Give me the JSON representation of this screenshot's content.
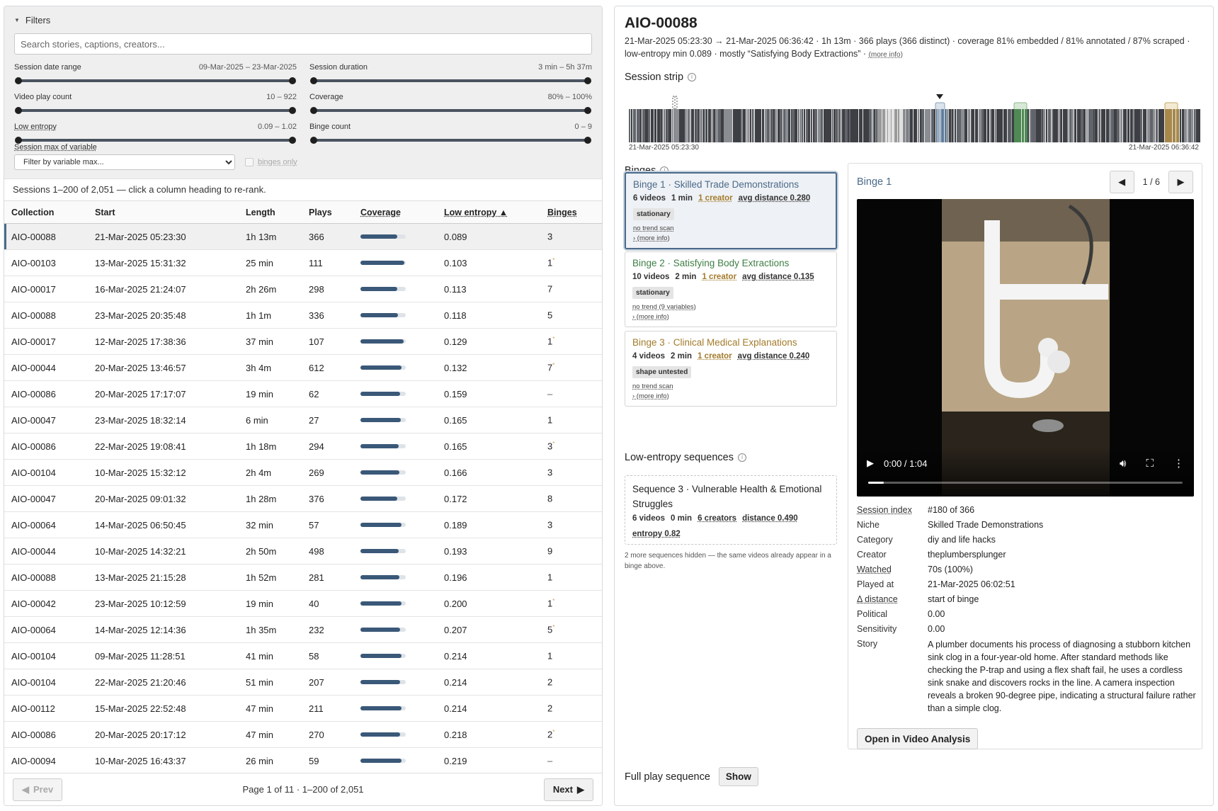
{
  "filters": {
    "heading": "Filters",
    "search_placeholder": "Search stories, captions, creators...",
    "sliders": [
      {
        "label": "Session date range",
        "range": "09-Mar-2025 – 23-Mar-2025"
      },
      {
        "label": "Session duration",
        "range": "3 min – 5h 37m"
      },
      {
        "label": "Video play count",
        "range": "10 – 922"
      },
      {
        "label": "Coverage",
        "range": "80% – 100%"
      },
      {
        "label": "Low entropy",
        "range": "0.09 – 1.02"
      },
      {
        "label": "Binge count",
        "range": "0 – 9"
      }
    ],
    "var_max_label": "Session max of variable",
    "var_max_select": "Filter by variable max...",
    "binges_only_label": "binges only"
  },
  "sessions": {
    "note": "Sessions 1–200 of 2,051 — click a column heading to re-rank.",
    "columns": [
      "Collection",
      "Start",
      "Length",
      "Plays",
      "Coverage",
      "Low entropy ▲",
      "Binges"
    ],
    "rows": [
      {
        "collection": "AIO-00088",
        "start": "21-Mar-2025 05:23:30",
        "length": "1h 13m",
        "plays": "366",
        "coverage": 0.81,
        "entropy": "0.089",
        "binges": "3",
        "mark": ""
      },
      {
        "collection": "AIO-00103",
        "start": "13-Mar-2025 15:31:32",
        "length": "25 min",
        "plays": "111",
        "coverage": 0.97,
        "entropy": "0.103",
        "binges": "1",
        "mark": "*"
      },
      {
        "collection": "AIO-00017",
        "start": "16-Mar-2025 21:24:07",
        "length": "2h 26m",
        "plays": "298",
        "coverage": 0.82,
        "entropy": "0.113",
        "binges": "7",
        "mark": ""
      },
      {
        "collection": "AIO-00088",
        "start": "23-Mar-2025 20:35:48",
        "length": "1h 1m",
        "plays": "336",
        "coverage": 0.83,
        "entropy": "0.118",
        "binges": "5",
        "mark": ""
      },
      {
        "collection": "AIO-00017",
        "start": "12-Mar-2025 17:38:36",
        "length": "37 min",
        "plays": "107",
        "coverage": 0.96,
        "entropy": "0.129",
        "binges": "1",
        "mark": "*"
      },
      {
        "collection": "AIO-00044",
        "start": "20-Mar-2025 13:46:57",
        "length": "3h 4m",
        "plays": "612",
        "coverage": 0.9,
        "entropy": "0.132",
        "binges": "7",
        "mark": "*"
      },
      {
        "collection": "AIO-00086",
        "start": "20-Mar-2025 17:17:07",
        "length": "19 min",
        "plays": "62",
        "coverage": 0.88,
        "entropy": "0.159",
        "binges": "–",
        "mark": ""
      },
      {
        "collection": "AIO-00047",
        "start": "23-Mar-2025 18:32:14",
        "length": "6 min",
        "plays": "27",
        "coverage": 0.89,
        "entropy": "0.165",
        "binges": "1",
        "mark": ""
      },
      {
        "collection": "AIO-00086",
        "start": "22-Mar-2025 19:08:41",
        "length": "1h 18m",
        "plays": "294",
        "coverage": 0.85,
        "entropy": "0.165",
        "binges": "3",
        "mark": "*"
      },
      {
        "collection": "AIO-00104",
        "start": "10-Mar-2025 15:32:12",
        "length": "2h 4m",
        "plays": "269",
        "coverage": 0.86,
        "entropy": "0.166",
        "binges": "3",
        "mark": ""
      },
      {
        "collection": "AIO-00047",
        "start": "20-Mar-2025 09:01:32",
        "length": "1h 28m",
        "plays": "376",
        "coverage": 0.82,
        "entropy": "0.172",
        "binges": "8",
        "mark": ""
      },
      {
        "collection": "AIO-00064",
        "start": "14-Mar-2025 06:50:45",
        "length": "32 min",
        "plays": "57",
        "coverage": 0.9,
        "entropy": "0.189",
        "binges": "3",
        "mark": ""
      },
      {
        "collection": "AIO-00044",
        "start": "10-Mar-2025 14:32:21",
        "length": "2h 50m",
        "plays": "498",
        "coverage": 0.85,
        "entropy": "0.193",
        "binges": "9",
        "mark": ""
      },
      {
        "collection": "AIO-00088",
        "start": "13-Mar-2025 21:15:28",
        "length": "1h 52m",
        "plays": "281",
        "coverage": 0.86,
        "entropy": "0.196",
        "binges": "1",
        "mark": ""
      },
      {
        "collection": "AIO-00042",
        "start": "23-Mar-2025 10:12:59",
        "length": "19 min",
        "plays": "40",
        "coverage": 0.9,
        "entropy": "0.200",
        "binges": "1",
        "mark": "*"
      },
      {
        "collection": "AIO-00064",
        "start": "14-Mar-2025 12:14:36",
        "length": "1h 35m",
        "plays": "232",
        "coverage": 0.88,
        "entropy": "0.207",
        "binges": "5",
        "mark": "*"
      },
      {
        "collection": "AIO-00104",
        "start": "09-Mar-2025 11:28:51",
        "length": "41 min",
        "plays": "58",
        "coverage": 0.9,
        "entropy": "0.214",
        "binges": "1",
        "mark": ""
      },
      {
        "collection": "AIO-00104",
        "start": "22-Mar-2025 21:20:46",
        "length": "51 min",
        "plays": "207",
        "coverage": 0.88,
        "entropy": "0.214",
        "binges": "2",
        "mark": ""
      },
      {
        "collection": "AIO-00112",
        "start": "15-Mar-2025 22:52:48",
        "length": "47 min",
        "plays": "211",
        "coverage": 0.9,
        "entropy": "0.214",
        "binges": "2",
        "mark": ""
      },
      {
        "collection": "AIO-00086",
        "start": "20-Mar-2025 20:17:12",
        "length": "47 min",
        "plays": "270",
        "coverage": 0.88,
        "entropy": "0.218",
        "binges": "2",
        "mark": "*"
      },
      {
        "collection": "AIO-00094",
        "start": "10-Mar-2025 16:43:37",
        "length": "26 min",
        "plays": "59",
        "coverage": 0.9,
        "entropy": "0.219",
        "binges": "–",
        "mark": ""
      }
    ]
  },
  "pager": {
    "prev": "Prev",
    "info": "Page 1 of 11 · 1–200 of 2,051",
    "next": "Next"
  },
  "session": {
    "title": "AIO-00088",
    "meta_line1": "21-Mar-2025 05:23:30 → 21-Mar-2025 06:36:42 · 1h 13m · 366 plays (366 distinct) · coverage 81% embedded / 81% annotated / 87% scraped ·",
    "meta_line2": "low-entropy min 0.089 · mostly “Satisfying Body Extractions” · ",
    "meta_more": "(more info)",
    "strip_heading": "Session strip",
    "strip_start": "21-Mar-2025 05:23:30",
    "strip_end": "21-Mar-2025 06:36:42",
    "binges_heading": "Binges",
    "binges": [
      {
        "title": "Binge 1 · Skilled Trade Demonstrations",
        "videos": "6 videos",
        "dur": "1 min",
        "creators": "1 creator",
        "dist": "avg distance 0.280",
        "badge": "stationary",
        "trend": "no trend scan",
        "more": "› (more info)",
        "color": "#4b6a8a"
      },
      {
        "title": "Binge 2 · Satisfying Body Extractions",
        "videos": "10 videos",
        "dur": "2 min",
        "creators": "1 creator",
        "dist": "avg distance 0.135",
        "badge": "stationary",
        "trend": "no trend (9 variables)",
        "more": "› (more info)",
        "color": "#3f7f45"
      },
      {
        "title": "Binge 3 · Clinical Medical Explanations",
        "videos": "4 videos",
        "dur": "2 min",
        "creators": "1 creator",
        "dist": "avg distance 0.240",
        "badge": "shape untested",
        "trend": "no trend scan",
        "more": "› (more info)",
        "color": "#a37b2b"
      }
    ],
    "seq_heading": "Low-entropy sequences",
    "sequence": {
      "title": "Sequence 3 · Vulnerable Health & Emotional Struggles",
      "videos": "6 videos",
      "dur": "0 min",
      "creators": "6 creators",
      "dist": "distance 0.490",
      "entropy": "entropy 0.82"
    },
    "seq_note": "2 more sequences hidden — the same videos already appear in a binge above.",
    "full_play_label": "Full play sequence",
    "show_btn": "Show"
  },
  "detail": {
    "heading": "Binge 1",
    "position": "1 / 6",
    "video_time": "0:00 / 1:04",
    "video_progress": 0.0,
    "fields": [
      {
        "k": "Session index",
        "v": "#180 of 366",
        "u": true
      },
      {
        "k": "Niche",
        "v": "Skilled Trade Demonstrations",
        "u": false
      },
      {
        "k": "Category",
        "v": "diy and life hacks",
        "u": false
      },
      {
        "k": "Creator",
        "v": "theplumbersplunger",
        "u": false
      },
      {
        "k": "Watched",
        "v": "70s (100%)",
        "u": true
      },
      {
        "k": "Played at",
        "v": "21-Mar-2025 06:02:51",
        "u": false
      },
      {
        "k": "Δ distance",
        "v": "start of binge",
        "u": true
      },
      {
        "k": "Political",
        "v": "0.00",
        "u": false
      },
      {
        "k": "Sensitivity",
        "v": "0.00",
        "u": false
      },
      {
        "k": "Story",
        "v": "A plumber documents his process of diagnosing a stubborn kitchen sink clog in a four-year-old home. After standard methods like checking the P-trap and using a flex shaft fail, he uses a cordless sink snake and discovers rocks in the line. A camera inspection reveals a broken 90-degree pipe, indicating a structural failure rather than a simple clog.",
        "u": false
      }
    ],
    "open_btn": "Open in Video Analysis"
  },
  "colors": {
    "accent": "#4b6a8a",
    "binge2": "#3f7f45",
    "binge3": "#a37b2b",
    "link": "#2b5f9e"
  }
}
